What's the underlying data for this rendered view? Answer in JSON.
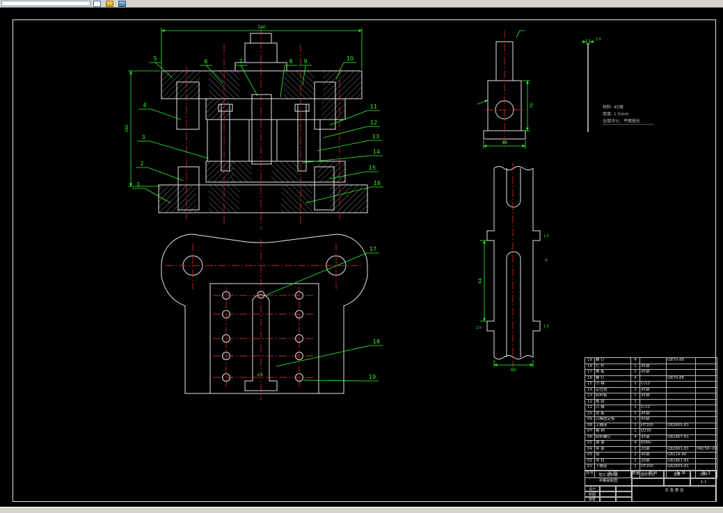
{
  "colors": {
    "accent_green": "#2bff2b",
    "centerline_red": "#ff3434",
    "line_white": "#e8e8e8",
    "chrome_gray": "#d6d3ce"
  },
  "toolbar": {
    "address_value": "",
    "icons": [
      "open-icon",
      "view-3d-icon",
      "print-icon"
    ]
  },
  "sheet": {
    "callouts": [
      "1",
      "2",
      "3",
      "4",
      "5",
      "6",
      "7",
      "8",
      "9",
      "10",
      "11",
      "12",
      "13",
      "14",
      "15",
      "16",
      "17",
      "18",
      "19"
    ],
    "dims": {
      "main_width": "240",
      "main_height": "160",
      "punch_width": "48",
      "punch_height": "70",
      "section_span": "64",
      "section_step": "2.5",
      "section_lip_top": "1.5",
      "section_mid": "4",
      "section_lip_bottom": "1.5",
      "section_width": "60",
      "plan_slot": "8.5",
      "strip_thickness": "1.5"
    },
    "notes": {
      "line1": "材料: 45钢",
      "line2": "厚度: 1.5mm",
      "line3": "全部淬火、平面抛光"
    },
    "bom": {
      "headers": [
        "序号",
        "名 称",
        "数量",
        "材 料",
        "标 准",
        "备 注"
      ],
      "rows": [
        {
          "no": "19",
          "name": "螺 钉",
          "qty": "4",
          "mat": "",
          "std": "GB70-88",
          "note": ""
        },
        {
          "no": "18",
          "name": "打 杆",
          "qty": "1",
          "mat": "45钢",
          "std": "",
          "note": ""
        },
        {
          "no": "17",
          "name": "推 板",
          "qty": "1",
          "mat": "45钢",
          "std": "",
          "note": ""
        },
        {
          "no": "16",
          "name": "螺 钉",
          "qty": "4",
          "mat": "",
          "std": "GB70-88",
          "note": ""
        },
        {
          "no": "15",
          "name": "凹 模",
          "qty": "1",
          "mat": "Cr12",
          "std": "",
          "note": ""
        },
        {
          "no": "14",
          "name": "定位销",
          "qty": "2",
          "mat": "45钢",
          "std": "",
          "note": ""
        },
        {
          "no": "13",
          "name": "卸料板",
          "qty": "1",
          "mat": "45钢",
          "std": "",
          "note": ""
        },
        {
          "no": "12",
          "name": "橡 胶",
          "qty": "1",
          "mat": "",
          "std": "",
          "note": ""
        },
        {
          "no": "11",
          "name": "凸 模",
          "qty": "1",
          "mat": "Cr12",
          "std": "",
          "note": ""
        },
        {
          "no": "10",
          "name": "垫 板",
          "qty": "1",
          "mat": "45钢",
          "std": "",
          "note": ""
        },
        {
          "no": "09",
          "name": "凸模固定板",
          "qty": "1",
          "mat": "45钢",
          "std": "",
          "note": ""
        },
        {
          "no": "08",
          "name": "上模座",
          "qty": "1",
          "mat": "HT200",
          "std": "GB2855-81",
          "note": ""
        },
        {
          "no": "07",
          "name": "模 柄",
          "qty": "1",
          "mat": "Q235",
          "std": "",
          "note": ""
        },
        {
          "no": "06",
          "name": "卸料螺钉",
          "qty": "4",
          "mat": "45钢",
          "std": "GB2867-81",
          "note": ""
        },
        {
          "no": "05",
          "name": "弹 簧",
          "qty": "4",
          "mat": "65Mn",
          "std": "",
          "note": ""
        },
        {
          "no": "04",
          "name": "导 套",
          "qty": "2",
          "mat": "20钢",
          "std": "GB2861-81",
          "note": "HRC58~62"
        },
        {
          "no": "03",
          "name": "销",
          "qty": "2",
          "mat": "45钢",
          "std": "GB119-86",
          "note": ""
        },
        {
          "no": "02",
          "name": "导 柱",
          "qty": "2",
          "mat": "20钢",
          "std": "GB2861-81",
          "note": ""
        },
        {
          "no": "01",
          "name": "下模座",
          "qty": "1",
          "mat": "HT200",
          "std": "GB2855-81",
          "note": ""
        }
      ]
    },
    "titleblock": {
      "title_line1": "垫片落料模",
      "title_line2": "冲模装配图",
      "mark_label": "图样标记",
      "weight_label": "重量",
      "scale_label": "比例",
      "mark_value": "",
      "weight_value": "",
      "scale_value": "1:1",
      "sheet_label": "共 张 第 张",
      "sign_rows": [
        {
          "label": "设计"
        },
        {
          "label": "制图"
        },
        {
          "label": "审核"
        }
      ]
    }
  }
}
